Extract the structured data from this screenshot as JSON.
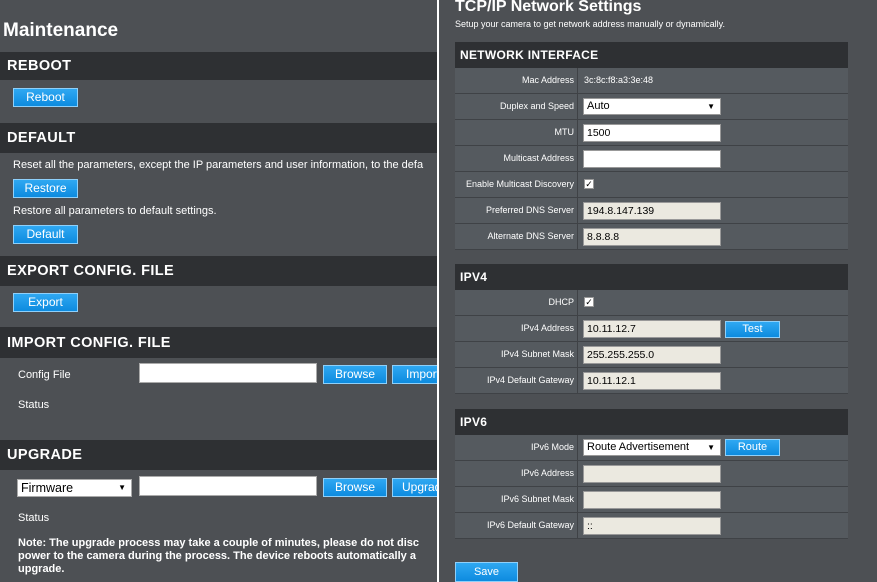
{
  "maintenance": {
    "title": "Maintenance",
    "reboot": {
      "heading": "REBOOT",
      "button": "Reboot"
    },
    "default": {
      "heading": "DEFAULT",
      "desc_restore": "Reset all the parameters, except the IP parameters and user information, to the defa",
      "restore_button": "Restore",
      "desc_default": "Restore all parameters to default settings.",
      "default_button": "Default"
    },
    "export": {
      "heading": "EXPORT CONFIG. FILE",
      "button": "Export"
    },
    "import": {
      "heading": "IMPORT CONFIG. FILE",
      "config_file_label": "Config File",
      "config_file_value": "",
      "browse_button": "Browse",
      "import_button": "Import",
      "status_label": "Status"
    },
    "upgrade": {
      "heading": "UPGRADE",
      "type_selected": "Firmware",
      "file_value": "",
      "browse_button": "Browse",
      "upgrade_button": "Upgrade",
      "status_label": "Status",
      "note_line1": "Note: The upgrade process may take a couple of minutes, please do not disc",
      "note_line2": "power to the camera during the process. The device reboots automatically a",
      "note_line3": "upgrade."
    }
  },
  "network": {
    "title": "TCP/IP Network Settings",
    "subtitle": "Setup your camera to get network address manually or dynamically.",
    "interface": {
      "heading": "NETWORK INTERFACE",
      "mac_label": "Mac Address",
      "mac_value": "3c:8c:f8:a3:3e:48",
      "duplex_label": "Duplex and Speed",
      "duplex_value": "Auto",
      "mtu_label": "MTU",
      "mtu_value": "1500",
      "multicast_label": "Multicast Address",
      "multicast_value": "",
      "discovery_label": "Enable Multicast Discovery",
      "discovery_checked": "✓",
      "dns1_label": "Preferred DNS Server",
      "dns1_value": "194.8.147.139",
      "dns2_label": "Alternate DNS Server",
      "dns2_value": "8.8.8.8"
    },
    "ipv4": {
      "heading": "IPV4",
      "dhcp_label": "DHCP",
      "dhcp_checked": "✓",
      "address_label": "IPv4 Address",
      "address_value": "10.11.12.7",
      "test_button": "Test",
      "mask_label": "IPv4 Subnet Mask",
      "mask_value": "255.255.255.0",
      "gateway_label": "IPv4 Default Gateway",
      "gateway_value": "10.11.12.1"
    },
    "ipv6": {
      "heading": "IPV6",
      "mode_label": "IPv6 Mode",
      "mode_value": "Route Advertisement",
      "route_button": "Route",
      "address_label": "IPv6 Address",
      "address_value": "",
      "mask_label": "IPv6 Subnet Mask",
      "mask_value": "",
      "gateway_label": "IPv6 Default Gateway",
      "gateway_value": "::"
    },
    "save_button": "Save"
  }
}
